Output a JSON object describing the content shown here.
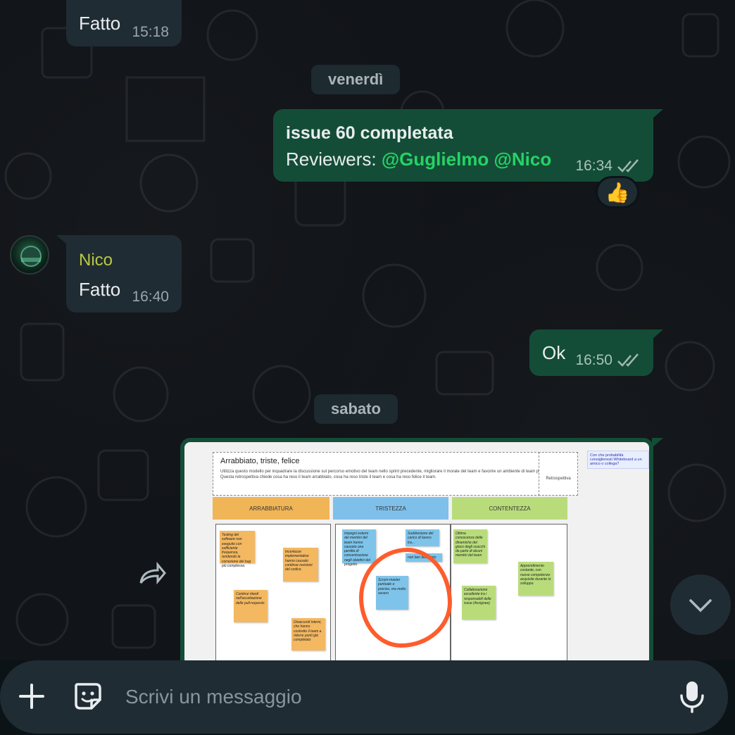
{
  "messages": [
    {
      "text": "Fatto",
      "time": "15:18"
    },
    {
      "date": "venerdì"
    },
    {
      "title": "issue 60 completata",
      "reviewers_label": "Reviewers:",
      "mention1": "@Guglielmo",
      "mention2": "@Nico",
      "time": "16:34",
      "reaction": "👍"
    },
    {
      "sender": "Nico",
      "text": "Fatto",
      "time": "16:40"
    },
    {
      "text": "Ok",
      "time": "16:50"
    },
    {
      "date": "sabato"
    }
  ],
  "image": {
    "board_title": "Arrabbiato, triste, felice",
    "board_desc": "Utilizza questo modello per inquadrare la discussione sul percorso emotivo del team nello sprint precedente, migliorare il morale del team e favorire un ambiente di team positivo. Questa retrospettiva chiede cosa ha reso il team arrabbiato, cosa ha reso triste il team e cosa ha reso felice il team.",
    "side_label": "Retrospettiva",
    "note": "Con che probabilità consiglieresti Whiteboard a un amico o collega?",
    "columns": [
      "ARRABBIATURA",
      "TRISTEZZA",
      "CONTENTEZZA"
    ],
    "stickies": [
      "Testing del software non eseguito con sufficiente frequenza, rendendo la correzione dei bug più complessa.",
      "Incertezze implementative hanno causato continue revisioni del codice.",
      "Continui ritardi nell'accettazione delle pull-requests",
      "Disaccordi interni, che hanno costretto il team a ridurre punti già completato",
      "Impegni esterni dei membri del team hanno causato una perdita di concentrazione negli obiettivi del progetto",
      "Suddivisione del carico di lavoro tra...",
      "non ben bilanciato",
      "Scrum-master puntuale e preciso, ma molto severo",
      "Ottima conoscenza delle dinamiche del gioco degli scacchi da parte di alcuni membri del team",
      "Apprendimento costante, con nuove competenze acquisite durante lo sviluppo.",
      "Collaborazione eccellente tra i responsabili delle issue (Assignee)"
    ]
  },
  "input": {
    "placeholder": "Scrivi un messaggio"
  },
  "icons": {
    "plus": "plus-icon",
    "sticker": "sticker-icon",
    "mic": "mic-icon",
    "forward": "forward-icon",
    "scroll": "chevron-down-icon"
  },
  "colors": {
    "outgoing": "#144d37",
    "incoming": "#202c33",
    "mention": "#25d366",
    "sender": "#b8c942"
  }
}
